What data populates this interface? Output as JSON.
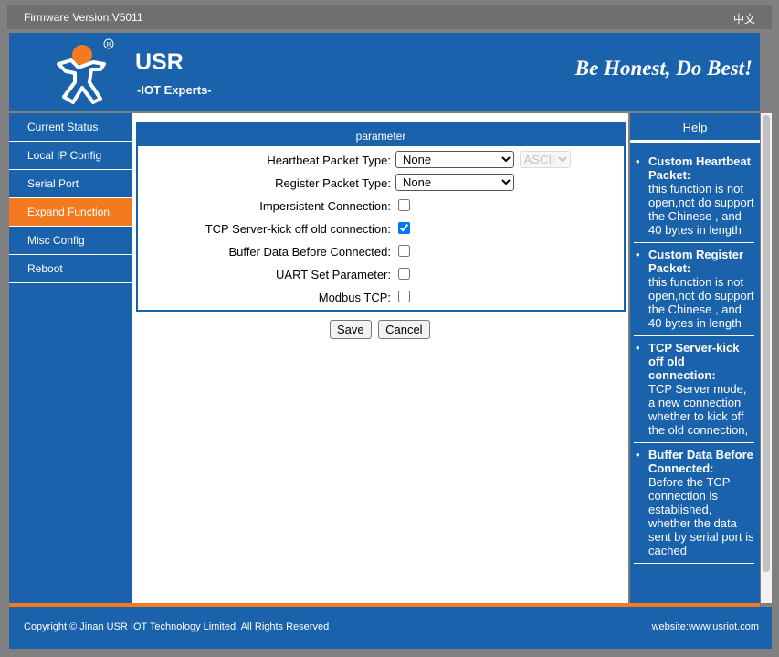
{
  "topbar": {
    "firmware": "Firmware Version:V5011",
    "language_link": "中文"
  },
  "header": {
    "brand": "USR",
    "subtitle": "-IOT Experts-",
    "slogan": "Be Honest, Do Best!",
    "logo_icon": "usr-runner-logo"
  },
  "sidebar": {
    "items": [
      {
        "label": "Current Status",
        "active": false
      },
      {
        "label": "Local IP Config",
        "active": false
      },
      {
        "label": "Serial Port",
        "active": false
      },
      {
        "label": "Expand Function",
        "active": true
      },
      {
        "label": "Misc Config",
        "active": false
      },
      {
        "label": "Reboot",
        "active": false
      }
    ]
  },
  "main": {
    "section_title": "parameter",
    "heartbeat_label": "Heartbeat Packet Type:",
    "heartbeat_value": "None",
    "heartbeat_format": "ASCII",
    "register_label": "Register Packet Type:",
    "register_value": "None",
    "impersistent_label": "Impersistent Connection:",
    "impersistent_checked": false,
    "kickoff_label": "TCP Server-kick off old connection:",
    "kickoff_checked": true,
    "buffer_label": "Buffer Data Before Connected:",
    "buffer_checked": false,
    "uart_label": "UART Set Parameter:",
    "uart_checked": false,
    "modbus_label": "Modbus TCP:",
    "modbus_checked": false,
    "save_label": "Save",
    "cancel_label": "Cancel"
  },
  "help": {
    "title": "Help",
    "items": [
      {
        "heading": "Custom Heartbeat Packet:",
        "text": "this function is not open,not do support the Chinese , and 40 bytes in length"
      },
      {
        "heading": "Custom Register Packet:",
        "text": "this function is not open,not do support the Chinese , and 40 bytes in length"
      },
      {
        "heading": "TCP Server-kick off old connection:",
        "text": "TCP Server mode, a new connection whether to kick off the old connection,"
      },
      {
        "heading": "Buffer Data Before Connected:",
        "text": "Before the TCP connection is established, whether the data sent by serial port is cached"
      }
    ]
  },
  "footer": {
    "copyright": "Copyright © Jinan USR IOT Technology Limited. All Rights Reserved",
    "website_label": "website:",
    "website_link": "www.usriot.com"
  },
  "colors": {
    "brand_blue": "#1a62ac",
    "accent_orange": "#f47a20"
  }
}
